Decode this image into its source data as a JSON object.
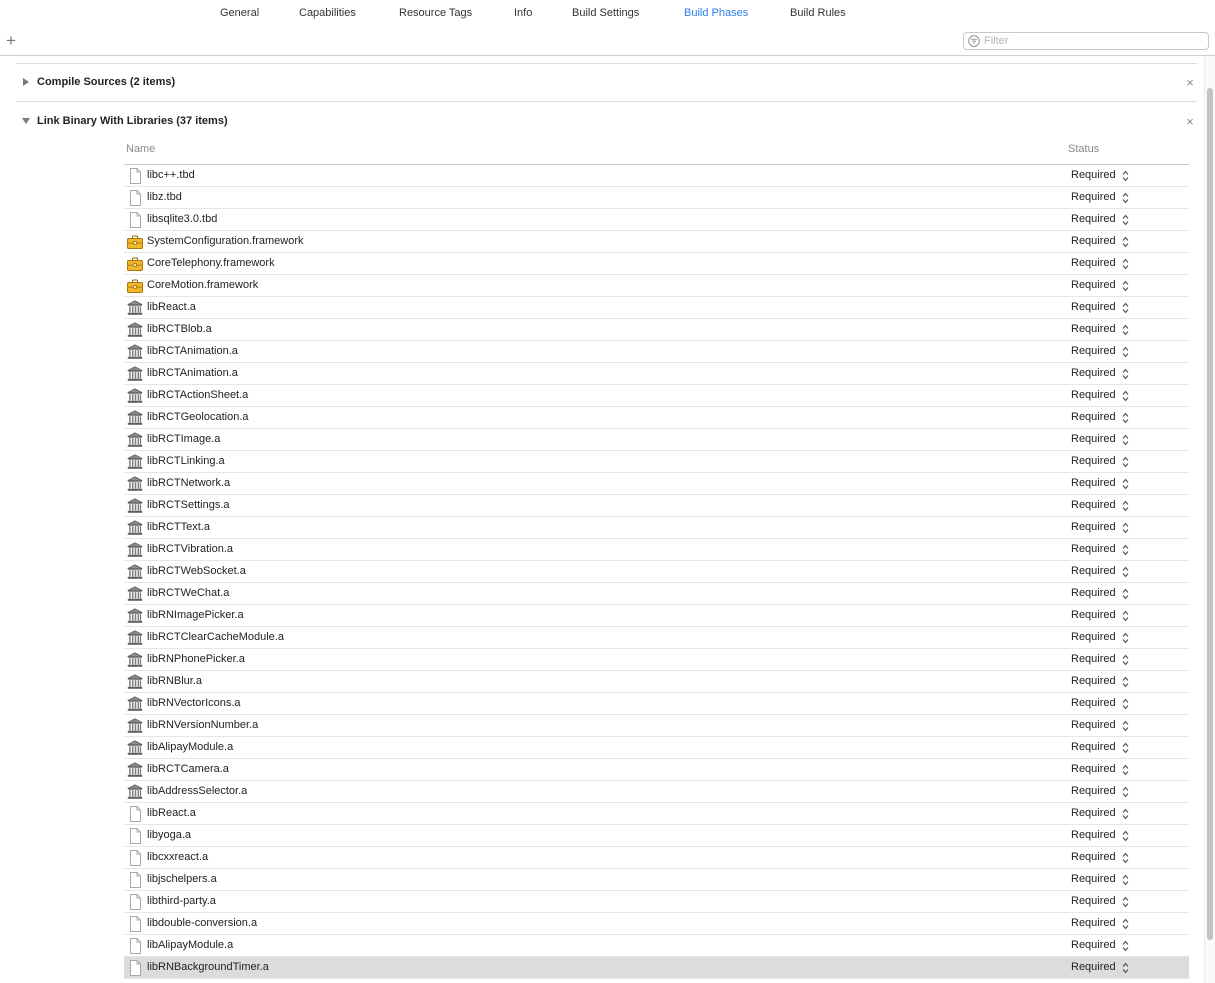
{
  "tabs": [
    {
      "label": "General",
      "active": false
    },
    {
      "label": "Capabilities",
      "active": false
    },
    {
      "label": "Resource Tags",
      "active": false
    },
    {
      "label": "Info",
      "active": false
    },
    {
      "label": "Build Settings",
      "active": false
    },
    {
      "label": "Build Phases",
      "active": true
    },
    {
      "label": "Build Rules",
      "active": false
    }
  ],
  "toolbar": {
    "add_label": "+",
    "filter_placeholder": "Filter",
    "filter_value": ""
  },
  "phases": {
    "compile": {
      "title": "Compile Sources (2 items)",
      "expanded": false,
      "close_label": "×"
    },
    "link": {
      "title": "Link Binary With Libraries (37 items)",
      "expanded": true,
      "close_label": "×"
    }
  },
  "table": {
    "col_name": "Name",
    "col_status": "Status",
    "rows": [
      {
        "name": "libc++.tbd",
        "status": "Required",
        "icon": "file-icon"
      },
      {
        "name": "libz.tbd",
        "status": "Required",
        "icon": "file-icon"
      },
      {
        "name": "libsqlite3.0.tbd",
        "status": "Required",
        "icon": "file-icon"
      },
      {
        "name": "SystemConfiguration.framework",
        "status": "Required",
        "icon": "framework-toolbox-icon"
      },
      {
        "name": "CoreTelephony.framework",
        "status": "Required",
        "icon": "framework-toolbox-icon"
      },
      {
        "name": "CoreMotion.framework",
        "status": "Required",
        "icon": "framework-toolbox-icon"
      },
      {
        "name": "libReact.a",
        "status": "Required",
        "icon": "static-library-icon"
      },
      {
        "name": "libRCTBlob.a",
        "status": "Required",
        "icon": "static-library-icon"
      },
      {
        "name": "libRCTAnimation.a",
        "status": "Required",
        "icon": "static-library-icon"
      },
      {
        "name": "libRCTAnimation.a",
        "status": "Required",
        "icon": "static-library-icon"
      },
      {
        "name": "libRCTActionSheet.a",
        "status": "Required",
        "icon": "static-library-icon"
      },
      {
        "name": "libRCTGeolocation.a",
        "status": "Required",
        "icon": "static-library-icon"
      },
      {
        "name": "libRCTImage.a",
        "status": "Required",
        "icon": "static-library-icon"
      },
      {
        "name": "libRCTLinking.a",
        "status": "Required",
        "icon": "static-library-icon"
      },
      {
        "name": "libRCTNetwork.a",
        "status": "Required",
        "icon": "static-library-icon"
      },
      {
        "name": "libRCTSettings.a",
        "status": "Required",
        "icon": "static-library-icon"
      },
      {
        "name": "libRCTText.a",
        "status": "Required",
        "icon": "static-library-icon"
      },
      {
        "name": "libRCTVibration.a",
        "status": "Required",
        "icon": "static-library-icon"
      },
      {
        "name": "libRCTWebSocket.a",
        "status": "Required",
        "icon": "static-library-icon"
      },
      {
        "name": "libRCTWeChat.a",
        "status": "Required",
        "icon": "static-library-icon"
      },
      {
        "name": "libRNImagePicker.a",
        "status": "Required",
        "icon": "static-library-icon"
      },
      {
        "name": "libRCTClearCacheModule.a",
        "status": "Required",
        "icon": "static-library-icon"
      },
      {
        "name": "libRNPhonePicker.a",
        "status": "Required",
        "icon": "static-library-icon"
      },
      {
        "name": "libRNBlur.a",
        "status": "Required",
        "icon": "static-library-icon"
      },
      {
        "name": "libRNVectorIcons.a",
        "status": "Required",
        "icon": "static-library-icon"
      },
      {
        "name": "libRNVersionNumber.a",
        "status": "Required",
        "icon": "static-library-icon"
      },
      {
        "name": "libAlipayModule.a",
        "status": "Required",
        "icon": "static-library-icon"
      },
      {
        "name": "libRCTCamera.a",
        "status": "Required",
        "icon": "static-library-icon"
      },
      {
        "name": "libAddressSelector.a",
        "status": "Required",
        "icon": "static-library-icon"
      },
      {
        "name": "libReact.a",
        "status": "Required",
        "icon": "file-icon"
      },
      {
        "name": "libyoga.a",
        "status": "Required",
        "icon": "file-icon"
      },
      {
        "name": "libcxxreact.a",
        "status": "Required",
        "icon": "file-icon"
      },
      {
        "name": "libjschelpers.a",
        "status": "Required",
        "icon": "file-icon"
      },
      {
        "name": "libthird-party.a",
        "status": "Required",
        "icon": "file-icon"
      },
      {
        "name": "libdouble-conversion.a",
        "status": "Required",
        "icon": "file-icon"
      },
      {
        "name": "libAlipayModule.a",
        "status": "Required",
        "icon": "file-icon"
      },
      {
        "name": "libRNBackgroundTimer.a",
        "status": "Required",
        "icon": "file-icon",
        "selected": true
      }
    ]
  },
  "colors": {
    "active_tab": "#2c7fe6",
    "selected_row": "#dcdcdc"
  }
}
